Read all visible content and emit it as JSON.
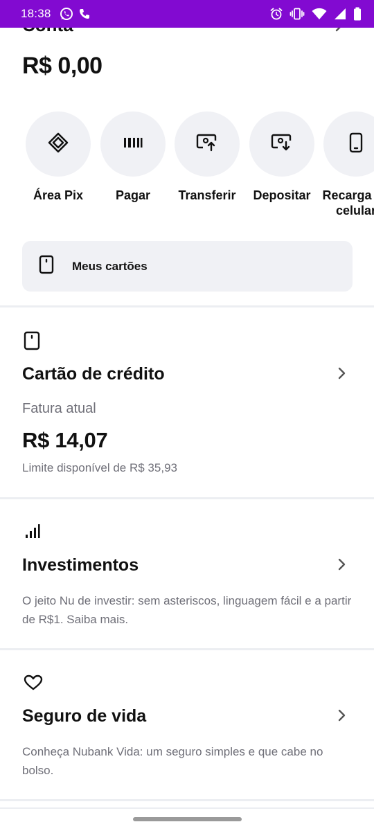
{
  "status_bar": {
    "time": "18:38",
    "background": "#820ad1",
    "left_icons": [
      "whatsapp-icon",
      "phone-icon"
    ],
    "right_icons": [
      "alarm-icon",
      "vibrate-icon",
      "wifi-icon",
      "signal-icon",
      "battery-icon"
    ]
  },
  "account": {
    "title": "Conta",
    "balance": "R$ 0,00"
  },
  "actions": [
    {
      "label": "Área Pix",
      "icon": "pix-icon"
    },
    {
      "label": "Pagar",
      "icon": "barcode-icon"
    },
    {
      "label": "Transferir",
      "icon": "transfer-icon"
    },
    {
      "label": "Depositar",
      "icon": "deposit-icon"
    },
    {
      "label": "Recarga de\ncelular",
      "icon": "phone-recharge-icon"
    }
  ],
  "my_cards": {
    "label": "Meus cartões",
    "icon": "card-icon"
  },
  "credit_card": {
    "title": "Cartão de crédito",
    "invoice_label": "Fatura atual",
    "invoice_value": "R$ 14,07",
    "limit_text": "Limite disponível de R$ 35,93"
  },
  "investments": {
    "title": "Investimentos",
    "description": "O jeito Nu de investir: sem asteriscos, linguagem fácil e a partir de R$1. Saiba mais."
  },
  "life_insurance": {
    "title": "Seguro de vida",
    "description": "Conheça Nubank Vida: um seguro simples e que cabe no bolso."
  }
}
